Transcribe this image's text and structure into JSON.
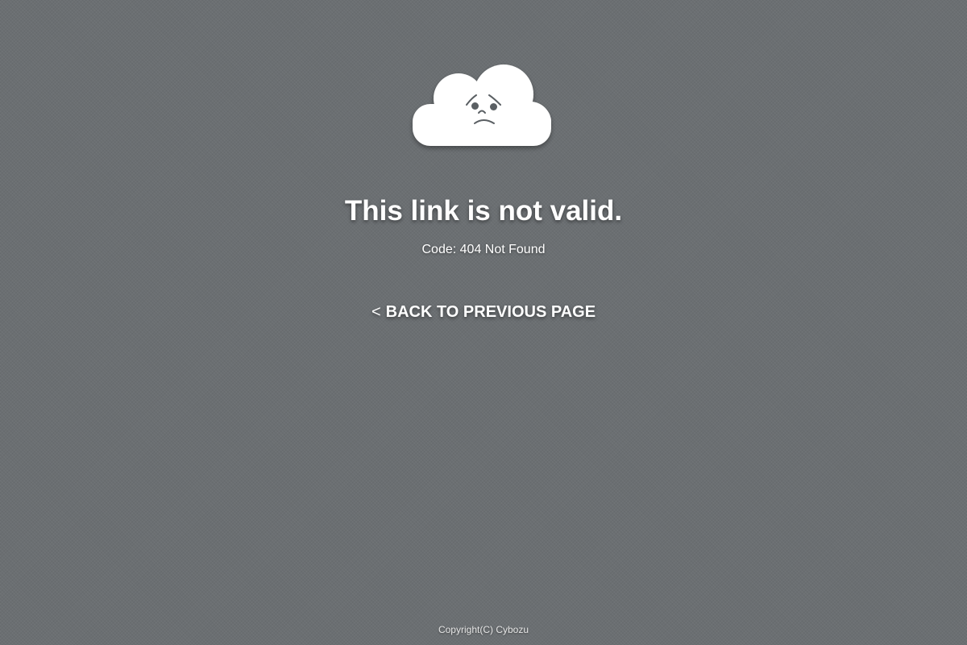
{
  "error": {
    "title": "This link is not valid.",
    "code": "Code: 404 Not Found",
    "icon": "sad-cloud-icon"
  },
  "navigation": {
    "back_arrow": "<",
    "back_label": "BACK TO PREVIOUS PAGE"
  },
  "footer": {
    "copyright": "Copyright(C) Cybozu"
  },
  "colors": {
    "background": "#6b6f72",
    "text": "#ffffff",
    "cloud": "#ffffff",
    "face": "#5a5f63"
  }
}
